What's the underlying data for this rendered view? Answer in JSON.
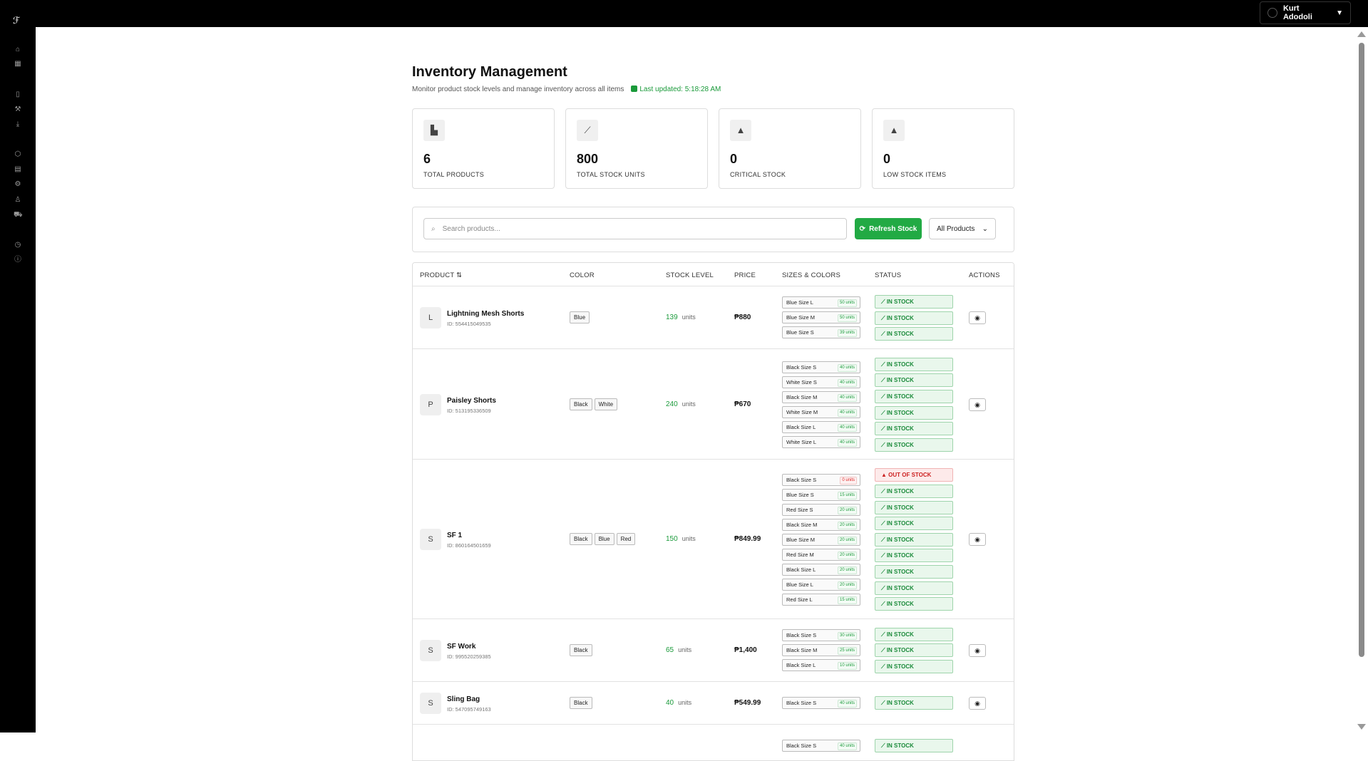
{
  "header": {
    "user_name": "Kurt Adodoli",
    "logo": "ℱ"
  },
  "sidebar": {
    "icons": [
      "home-icon",
      "grid-icon",
      "clipboard-icon",
      "wrench-icon",
      "download-icon",
      "box-icon",
      "calendar-icon",
      "settings-icon",
      "user-plus-icon",
      "truck-icon",
      "clock-icon",
      "info-icon"
    ]
  },
  "page": {
    "title": "Inventory Management",
    "subtitle": "Monitor product stock levels and manage inventory across all items",
    "last_updated": "Last updated: 5:18:28 AM"
  },
  "stats": [
    {
      "value": "6",
      "label": "TOTAL PRODUCTS",
      "icon": "boxes-icon"
    },
    {
      "value": "800",
      "label": "TOTAL STOCK UNITS",
      "icon": "chart-icon"
    },
    {
      "value": "0",
      "label": "CRITICAL STOCK",
      "icon": "warning-icon"
    },
    {
      "value": "0",
      "label": "LOW STOCK ITEMS",
      "icon": "warning-icon"
    }
  ],
  "filters": {
    "search_placeholder": "Search products...",
    "refresh_label": "Refresh Stock",
    "select_value": "All Products"
  },
  "table": {
    "headers": [
      "PRODUCT",
      "COLOR",
      "STOCK LEVEL",
      "PRICE",
      "SIZES & COLORS",
      "STATUS",
      "ACTIONS"
    ],
    "units_label": "units",
    "in_stock_label": "IN STOCK",
    "out_of_stock_label": "OUT OF STOCK",
    "rows": [
      {
        "initial": "L",
        "name": "Lightning Mesh Shorts",
        "id": "ID: 554415049535",
        "colors": [
          "Blue"
        ],
        "stock": "139",
        "price": "₱880",
        "sizes": [
          [
            "Blue Size L",
            "50 units"
          ],
          [
            "Blue Size M",
            "50 units"
          ],
          [
            "Blue Size S",
            "39 units"
          ]
        ],
        "status": [
          "in",
          "in",
          "in"
        ]
      },
      {
        "initial": "P",
        "name": "Paisley Shorts",
        "id": "ID: 513195336509",
        "colors": [
          "Black",
          "White"
        ],
        "stock": "240",
        "price": "₱670",
        "sizes": [
          [
            "Black Size S",
            "40 units"
          ],
          [
            "White Size S",
            "40 units"
          ],
          [
            "Black Size M",
            "40 units"
          ],
          [
            "White Size M",
            "40 units"
          ],
          [
            "Black Size L",
            "40 units"
          ],
          [
            "White Size L",
            "40 units"
          ]
        ],
        "status": [
          "in",
          "in",
          "in",
          "in",
          "in",
          "in"
        ]
      },
      {
        "initial": "S",
        "name": "SF 1",
        "id": "ID: 860164501659",
        "colors": [
          "Black",
          "Blue",
          "Red"
        ],
        "stock": "150",
        "price": "₱849.99",
        "sizes": [
          [
            "Black Size S",
            "0 units"
          ],
          [
            "Blue Size S",
            "15 units"
          ],
          [
            "Red Size S",
            "20 units"
          ],
          [
            "Black Size M",
            "20 units"
          ],
          [
            "Blue Size M",
            "20 units"
          ],
          [
            "Red Size M",
            "20 units"
          ],
          [
            "Black Size L",
            "20 units"
          ],
          [
            "Blue Size L",
            "20 units"
          ],
          [
            "Red Size L",
            "15 units"
          ]
        ],
        "status": [
          "out",
          "in",
          "in",
          "in",
          "in",
          "in",
          "in",
          "in",
          "in"
        ]
      },
      {
        "initial": "S",
        "name": "SF Work",
        "id": "ID: 995520259385",
        "colors": [
          "Black"
        ],
        "stock": "65",
        "price": "₱1,400",
        "sizes": [
          [
            "Black Size S",
            "30 units"
          ],
          [
            "Black Size M",
            "25 units"
          ],
          [
            "Black Size L",
            "10 units"
          ]
        ],
        "status": [
          "in",
          "in",
          "in"
        ]
      },
      {
        "initial": "S",
        "name": "Sling Bag",
        "id": "ID: 547095749163",
        "colors": [
          "Black"
        ],
        "stock": "40",
        "price": "₱549.99",
        "sizes": [
          [
            "Black Size S",
            "40 units"
          ]
        ],
        "status": [
          "in"
        ]
      },
      {
        "initial": "",
        "name": "",
        "id": "",
        "colors": [],
        "stock": "",
        "price": "",
        "sizes": [
          [
            "Black Size S",
            "40 units"
          ]
        ],
        "status": [
          "in"
        ]
      }
    ]
  }
}
